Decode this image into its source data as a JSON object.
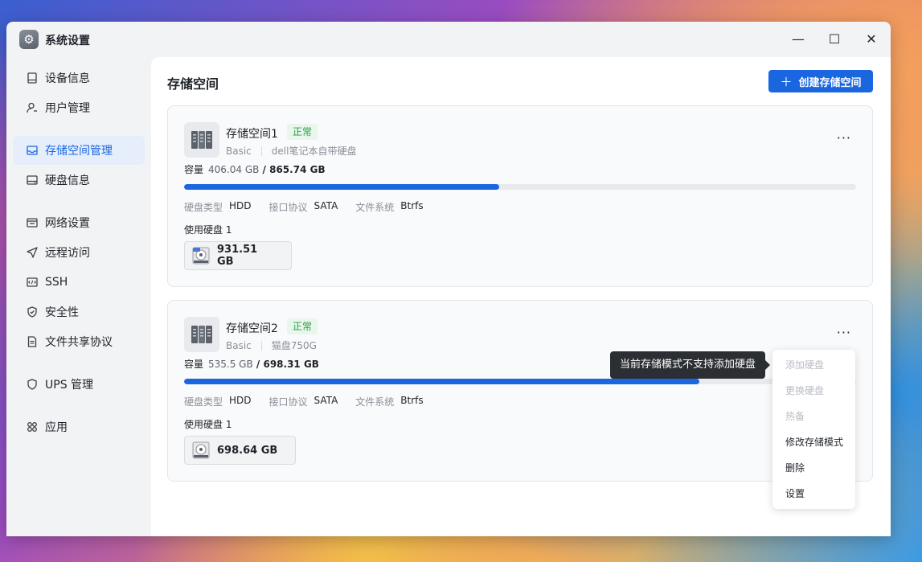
{
  "window": {
    "title": "系统设置",
    "minimize": "—",
    "maximize": "☐",
    "close": "✕"
  },
  "sidebar": {
    "items": [
      {
        "label": "设备信息",
        "icon": "device-icon",
        "active": false
      },
      {
        "label": "用户管理",
        "icon": "user-icon",
        "active": false
      },
      {
        "label": "存储空间管理",
        "icon": "storage-icon",
        "active": true
      },
      {
        "label": "硬盘信息",
        "icon": "disk-icon",
        "active": false
      },
      {
        "label": "网络设置",
        "icon": "network-icon",
        "active": false
      },
      {
        "label": "远程访问",
        "icon": "remote-icon",
        "active": false
      },
      {
        "label": "SSH",
        "icon": "ssh-icon",
        "active": false
      },
      {
        "label": "安全性",
        "icon": "shield-icon",
        "active": false
      },
      {
        "label": "文件共享协议",
        "icon": "file-share-icon",
        "active": false
      },
      {
        "label": "UPS 管理",
        "icon": "ups-icon",
        "active": false
      },
      {
        "label": "应用",
        "icon": "apps-icon",
        "active": false
      }
    ]
  },
  "main": {
    "title": "存储空间",
    "create_button": "创建存储空间",
    "create_plus": "＋"
  },
  "pools": [
    {
      "name": "存储空间1",
      "status": "正常",
      "mode": "Basic",
      "description": "dell笔记本自带硬盘",
      "more": "···",
      "capacity_label": "容量",
      "used": "406.04 GB",
      "slash": " / ",
      "total": "865.74 GB",
      "usage_fraction": 0.469,
      "disk_type_label": "硬盘类型",
      "disk_type": "HDD",
      "interface_label": "接口协议",
      "interface": "SATA",
      "fs_label": "文件系统",
      "fs": "Btrfs",
      "disks_used_label": "使用硬盘 1",
      "disk_size": "931.51 GB"
    },
    {
      "name": "存储空间2",
      "status": "正常",
      "mode": "Basic",
      "description": "猫盘750G",
      "more": "···",
      "capacity_label": "容量",
      "used": "535.5 GB",
      "slash": " / ",
      "total": "698.31 GB",
      "usage_fraction": 0.767,
      "disk_type_label": "硬盘类型",
      "disk_type": "HDD",
      "interface_label": "接口协议",
      "interface": "SATA",
      "fs_label": "文件系统",
      "fs": "Btrfs",
      "disks_used_label": "使用硬盘 1",
      "disk_size": "698.64 GB"
    }
  ],
  "tooltip": "当前存储模式不支持添加硬盘",
  "context_menu": [
    {
      "label": "添加硬盘",
      "disabled": true
    },
    {
      "label": "更换硬盘",
      "disabled": true
    },
    {
      "label": "热备",
      "disabled": true
    },
    {
      "label": "修改存储模式",
      "disabled": false
    },
    {
      "label": "删除",
      "disabled": false
    },
    {
      "label": "设置",
      "disabled": false
    }
  ],
  "colors": {
    "accent": "#1a66e0",
    "status_ok": "#2ba04a"
  }
}
